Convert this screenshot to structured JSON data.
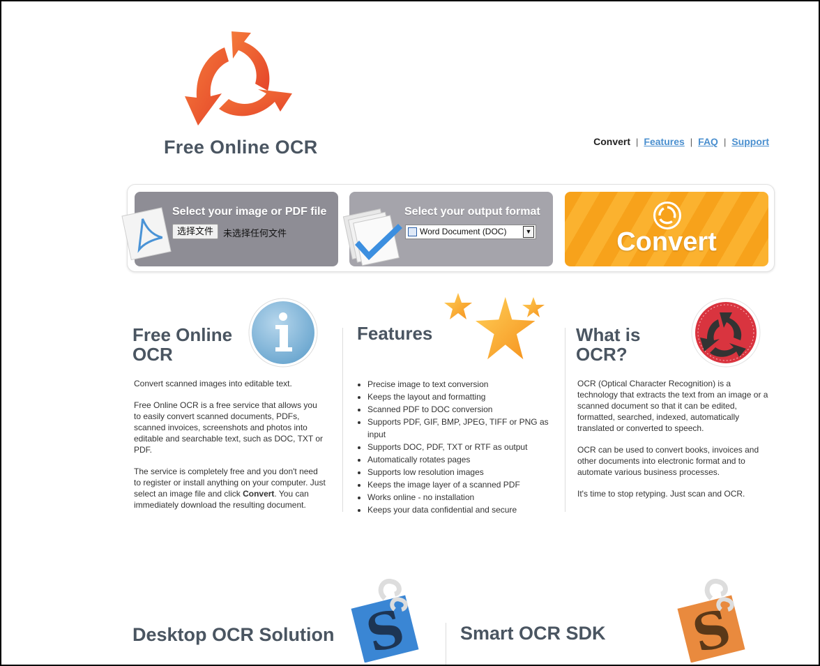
{
  "header": {
    "logo_title": "Free Online OCR",
    "nav": {
      "current": "Convert",
      "features": "Features",
      "faq": "FAQ",
      "support": "Support",
      "separator": "|"
    }
  },
  "converter": {
    "step1_title": "Select your image or PDF file",
    "file_button": "选择文件",
    "file_status": "未选择任何文件",
    "step2_title": "Select your output format",
    "format_selected": "Word Document (DOC)",
    "convert_label": "Convert"
  },
  "about": {
    "title": "Free Online OCR",
    "p1": "Convert scanned images into editable text.",
    "p2": "Free Online OCR is a free service that allows you to easily convert scanned documents, PDFs, scanned invoices, screenshots and photos into editable and searchable text, such as DOC, TXT or PDF.",
    "p3_start": "The service is completely free and you don't need to register or install anything on your computer. Just select an image file and click ",
    "p3_bold": "Convert",
    "p3_end": ". You can immediately download the resulting document."
  },
  "features": {
    "title": "Features",
    "items": [
      "Precise image to text conversion",
      "Keeps the layout and formatting",
      "Scanned PDF to DOC conversion",
      "Supports PDF, GIF, BMP, JPEG, TIFF or PNG as input",
      "Supports DOC, PDF, TXT or RTF as output",
      "Automatically rotates pages",
      "Supports low resolution images",
      "Keeps the image layer of a scanned PDF",
      "Works online - no installation",
      "Keeps your data confidential and secure"
    ]
  },
  "what_is": {
    "title": "What is OCR?",
    "p1": "OCR (Optical Character Recognition) is a technology that extracts the text from an image or a scanned document so that it can be edited, formatted, searched, indexed, automatically translated or converted to speech.",
    "p2": "OCR can be used to convert books, invoices and other documents into electronic format and to automate various business processes.",
    "p3": "It's time to stop retyping. Just scan and OCR."
  },
  "bottom": {
    "desktop_title": "Desktop OCR Solution",
    "sdk_title": "Smart OCR SDK"
  },
  "colors": {
    "heading": "#4a5561",
    "link": "#4a8fcf",
    "convert_orange": "#f7a21b",
    "panel_gray": "#8e8d95"
  },
  "icons": {
    "logo": "recycle-arrows-icon",
    "pdf": "pdf-file-icon",
    "format": "documents-check-icon",
    "convert": "convert-arrows-icon",
    "info": "info-icon",
    "stars": "stars-icon",
    "ocr": "ocr-arrows-icon",
    "desktop": "s-logo-blue-icon",
    "sdk": "s-logo-orange-icon"
  }
}
